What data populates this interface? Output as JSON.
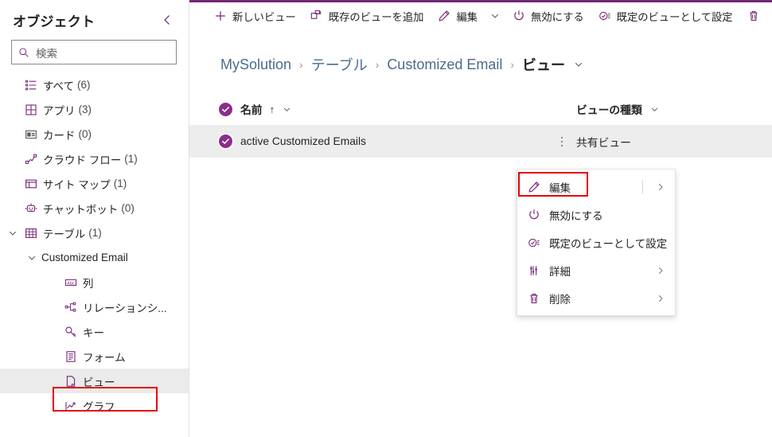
{
  "sidebar": {
    "title": "オブジェクト",
    "collapse_icon": "chevron-left-icon",
    "search": {
      "placeholder": "検索",
      "icon": "search-icon"
    },
    "items": [
      {
        "label": "すべて",
        "count": "(6)",
        "icon": "all-list-icon",
        "level": 0,
        "twisty": "",
        "selected": false
      },
      {
        "label": "アプリ",
        "count": "(3)",
        "icon": "app-grid-icon",
        "level": 0,
        "twisty": "",
        "selected": false
      },
      {
        "label": "カード",
        "count": "(0)",
        "icon": "card-icon",
        "level": 0,
        "twisty": "",
        "selected": false
      },
      {
        "label": "クラウド フロー",
        "count": "(1)",
        "icon": "cloud-flow-icon",
        "level": 0,
        "twisty": "",
        "selected": false
      },
      {
        "label": "サイト マップ",
        "count": "(1)",
        "icon": "sitemap-icon",
        "level": 0,
        "twisty": "",
        "selected": false
      },
      {
        "label": "チャットボット",
        "count": "(0)",
        "icon": "chatbot-icon",
        "level": 0,
        "twisty": "",
        "selected": false
      },
      {
        "label": "テーブル",
        "count": "(1)",
        "icon": "table-icon",
        "level": 0,
        "twisty": "chevron-down-icon",
        "selected": false
      },
      {
        "label": "Customized Email",
        "count": "",
        "icon": "",
        "level": 1,
        "twisty": "chevron-down-icon",
        "selected": false
      },
      {
        "label": "列",
        "count": "",
        "icon": "columns-abc-icon",
        "level": 2,
        "twisty": "",
        "selected": false
      },
      {
        "label": "リレーションシ...",
        "count": "",
        "icon": "relationships-icon",
        "level": 2,
        "twisty": "",
        "selected": false
      },
      {
        "label": "キー",
        "count": "",
        "icon": "key-icon",
        "level": 2,
        "twisty": "",
        "selected": false
      },
      {
        "label": "フォーム",
        "count": "",
        "icon": "form-icon",
        "level": 2,
        "twisty": "",
        "selected": false
      },
      {
        "label": "ビュー",
        "count": "",
        "icon": "view-page-icon",
        "level": 2,
        "twisty": "",
        "selected": true
      },
      {
        "label": "グラフ",
        "count": "",
        "icon": "chart-icon",
        "level": 2,
        "twisty": "",
        "selected": false
      }
    ]
  },
  "commandbar": {
    "items": [
      {
        "label": "新しいビュー",
        "icon": "plus-icon"
      },
      {
        "label": "既存のビューを追加",
        "icon": "add-existing-view-icon"
      },
      {
        "label": "編集",
        "icon": "pencil-icon"
      }
    ],
    "edit_caret_icon": "chevron-down-icon",
    "items2": [
      {
        "label": "無効にする",
        "icon": "power-icon"
      },
      {
        "label": "既定のビューとして設定",
        "icon": "default-view-icon"
      }
    ],
    "delete_icon": "trash-icon"
  },
  "breadcrumb": {
    "crumbs": [
      "MySolution",
      "テーブル",
      "Customized Email"
    ],
    "current": "ビュー",
    "separator": "›",
    "caret_icon": "chevron-down-icon"
  },
  "table": {
    "columns": [
      {
        "label": "名前",
        "sort": "↑",
        "caret_icon": "chevron-down-icon"
      },
      {
        "label": "ビューの種類",
        "sort": "",
        "caret_icon": "chevron-down-icon"
      }
    ],
    "rows": [
      {
        "name": "active Customized Emails",
        "type": "共有ビュー",
        "checked": true,
        "more_icon": "more-vertical-icon"
      }
    ],
    "header_check_icon": "checkmark-circle-icon"
  },
  "context_menu": {
    "items": [
      {
        "label": "編集",
        "icon": "pencil-icon",
        "split": true,
        "chevron": true,
        "highlighted": true
      },
      {
        "label": "無効にする",
        "icon": "power-icon",
        "split": false,
        "chevron": false,
        "highlighted": false
      },
      {
        "label": "既定のビューとして設定",
        "icon": "default-view-icon",
        "split": false,
        "chevron": false,
        "highlighted": false
      },
      {
        "label": "詳細",
        "icon": "details-icon",
        "split": false,
        "chevron": true,
        "highlighted": false
      },
      {
        "label": "削除",
        "icon": "trash-icon",
        "split": false,
        "chevron": true,
        "highlighted": false
      }
    ]
  },
  "colors": {
    "accent_purple": "#742774",
    "check_purple": "#8b2e8b",
    "annotation_red": "#e60000",
    "row_selected_gray": "#ededed",
    "sidebar_selected_gray": "#ebebeb"
  }
}
